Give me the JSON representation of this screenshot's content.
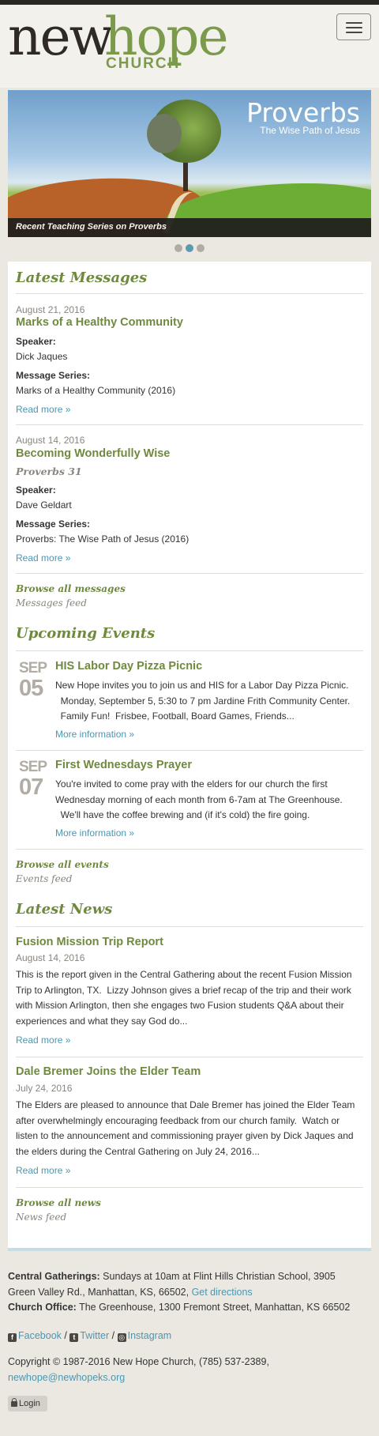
{
  "header": {
    "logo": {
      "word1": "new",
      "word2": "hope",
      "word3": "CHURCH"
    },
    "menu_toggle_label": "Toggle navigation"
  },
  "banner": {
    "title": "Proverbs",
    "subtitle": "The Wise Path of Jesus",
    "caption": "Recent Teaching Series on Proverbs",
    "slide_count": 3,
    "active_slide": 2
  },
  "messages": {
    "heading": "Latest Messages",
    "speaker_label": "Speaker:",
    "series_label": "Message Series:",
    "read_more": "Read more »",
    "items": [
      {
        "date": "August 21, 2016",
        "title": "Marks of a Healthy Community",
        "scripture": "",
        "speaker": "Dick Jaques",
        "series": "Marks of a Healthy Community (2016)"
      },
      {
        "date": "August 14, 2016",
        "title": "Becoming Wonderfully Wise",
        "scripture": "Proverbs 31",
        "speaker": "Dave Geldart",
        "series": "Proverbs: The Wise Path of Jesus (2016)"
      }
    ],
    "browse": "Browse all messages",
    "feed": "Messages feed"
  },
  "events": {
    "heading": "Upcoming Events",
    "more": "More information »",
    "items": [
      {
        "month": "SEP",
        "day": "05",
        "title": "HIS Labor Day Pizza Picnic",
        "lines": [
          "New Hope invites you to join us and HIS for a Labor Day Pizza Picnic.",
          "  Monday, September 5, 5:30 to 7 pm Jardine Frith Community Center.",
          "  Family Fun!  Frisbee, Football, Board Games, Friends..."
        ]
      },
      {
        "month": "SEP",
        "day": "07",
        "title": "First Wednesdays Prayer",
        "lines": [
          "You're invited to come pray with the elders for our church the first",
          "Wednesday morning of each month from 6-7am at The Greenhouse.",
          "  We'll have the coffee brewing and (if it's cold) the fire going."
        ]
      }
    ],
    "browse": "Browse all events",
    "feed": "Events feed"
  },
  "news": {
    "heading": "Latest News",
    "read_more": "Read more »",
    "items": [
      {
        "title": "Fusion Mission Trip Report",
        "date": "August 14, 2016",
        "lines": [
          "This is the report given in the Central Gathering about the recent Fusion Mission",
          "Trip to Arlington, TX.  Lizzy Johnson gives a brief recap of the trip and their work",
          "with Mission Arlington, then she engages two Fusion students Q&A about their",
          "experiences and what they say God do..."
        ]
      },
      {
        "title": "Dale Bremer Joins the Elder Team",
        "date": "July 24, 2016",
        "lines": [
          "The Elders are pleased to announce that Dale Bremer has joined the Elder Team",
          "after overwhelmingly encouraging feedback from our church family.  Watch or",
          "listen to the announcement and commissioning prayer given by Dick Jaques and",
          "the elders during the Central Gathering on July 24, 2016..."
        ]
      }
    ],
    "browse": "Browse all news",
    "feed": "News feed"
  },
  "footer": {
    "gatherings_label": "Central Gatherings:",
    "gatherings_text_1": "Sundays at 10am at Flint Hills Christian School, 3905",
    "gatherings_text_2": "Green Valley Rd., Manhattan, KS, 66502,",
    "directions": "Get directions",
    "office_label": "Church Office:",
    "office_text": "The Greenhouse, 1300 Fremont Street, Manhattan, KS 66502",
    "facebook": "Facebook",
    "twitter": "Twitter",
    "instagram": "Instagram",
    "separator": "/",
    "copyright_line1": "Copyright © 1987-2016 New Hope Church, (785) 537-2389,",
    "email": "newhope@newhopeks.org",
    "login": "Login"
  },
  "colors": {
    "accent_green": "#6f8a3f",
    "link_blue": "#4a97b3",
    "background": "#ebe8e1"
  }
}
